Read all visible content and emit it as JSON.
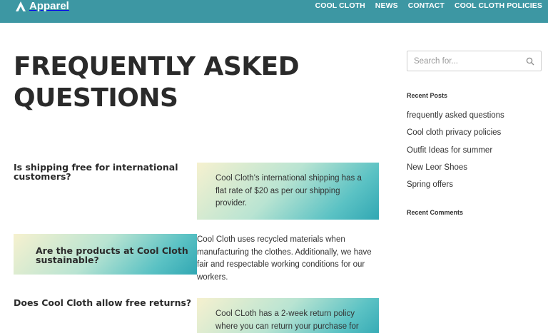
{
  "header": {
    "brand_name": "Apparel",
    "logo_icon": "apparel-logo-icon",
    "nav": [
      {
        "label": "COOL CLOTH"
      },
      {
        "label": "NEWS"
      },
      {
        "label": "CONTACT"
      },
      {
        "label": "COOL CLOTH POLICIES"
      }
    ]
  },
  "main": {
    "title": "FREQUENTLY ASKED QUESTIONS",
    "faq": [
      {
        "question": "Is shipping free for international customers?",
        "answer": "Cool Cloth's international shipping has a flat rate of $20 as per our shipping provider."
      },
      {
        "question": "Are the products at Cool Cloth sustainable?",
        "answer": "Cool Cloth uses recycled materials when manufacturing the clothes. Additionally, we have fair and respectable working conditions for our workers."
      },
      {
        "question": "Does Cool Cloth allow free returns?",
        "answer": "Cool CLoth has a 2-week return policy where you can return your purchase for"
      }
    ]
  },
  "sidebar": {
    "search": {
      "placeholder": "Search for...",
      "icon": "search-icon"
    },
    "recent_posts_title": "Recent Posts",
    "recent_posts": [
      {
        "label": "frequently asked questions"
      },
      {
        "label": "Cool cloth privacy policies"
      },
      {
        "label": "Outfit Ideas for summer"
      },
      {
        "label": "New Leor Shoes"
      },
      {
        "label": "Spring offers"
      }
    ],
    "recent_comments_title": "Recent Comments"
  },
  "colors": {
    "header_bg": "#3d97a3",
    "gradient": [
      "#f6f1cf",
      "#b9e4d2",
      "#5bc2c4",
      "#31a7b3"
    ]
  }
}
